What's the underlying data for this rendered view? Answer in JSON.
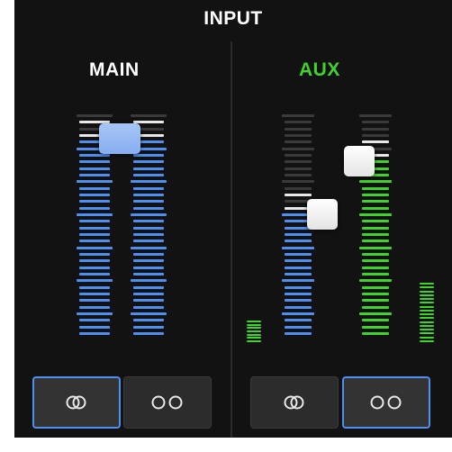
{
  "header": {
    "title": "INPUT"
  },
  "main": {
    "label": "MAIN",
    "meter_colors": {
      "active": "#4f8ff2",
      "inactive": "#3a3a3a",
      "peak": "#e8e8e8"
    },
    "fader_level": 0.88,
    "buttons": [
      {
        "icon": "stereo-link-icon",
        "selected": true
      },
      {
        "icon": "dual-mono-icon",
        "selected": false
      }
    ]
  },
  "aux": {
    "label": "AUX",
    "label_color": "#3fd32b",
    "meter_colors": {
      "left": "#4f8ff2",
      "right": "#3fd32b",
      "inactive": "#3a3a3a",
      "peak": "#e8e8e8"
    },
    "left_fader_level": 0.55,
    "right_fader_level": 0.78,
    "buttons": [
      {
        "icon": "stereo-link-icon",
        "selected": false
      },
      {
        "icon": "dual-mono-icon",
        "selected": true
      }
    ]
  },
  "colors": {
    "background": "#121212",
    "selected_outline": "#4f8ff2"
  }
}
